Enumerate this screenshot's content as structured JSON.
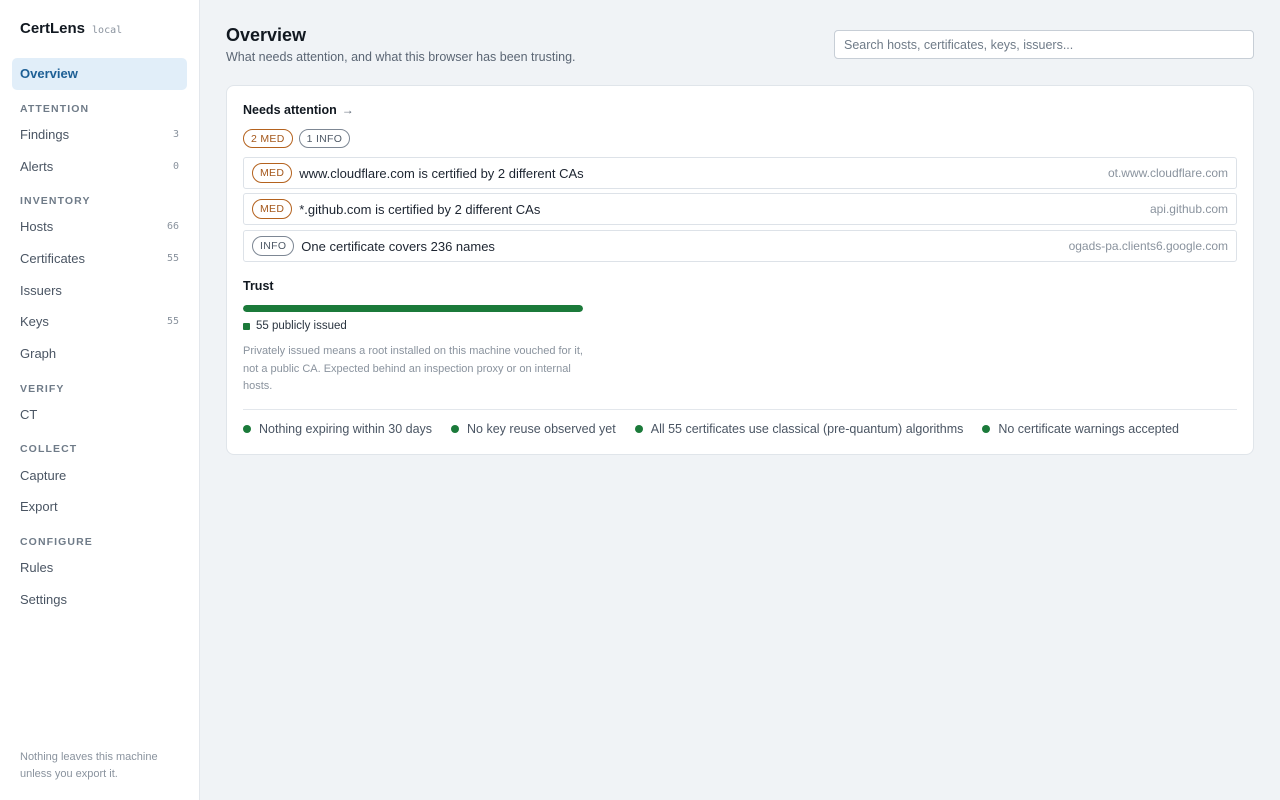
{
  "app": {
    "name": "CertLens",
    "tag": "local"
  },
  "sidebar": {
    "overview": "Overview",
    "sections": {
      "attention": "ATTENTION",
      "inventory": "INVENTORY",
      "verify": "VERIFY",
      "collect": "COLLECT",
      "configure": "CONFIGURE"
    },
    "items": {
      "findings": {
        "label": "Findings",
        "count": "3"
      },
      "alerts": {
        "label": "Alerts",
        "count": "0"
      },
      "hosts": {
        "label": "Hosts",
        "count": "66"
      },
      "certificates": {
        "label": "Certificates",
        "count": "55"
      },
      "issuers": {
        "label": "Issuers"
      },
      "keys": {
        "label": "Keys",
        "count": "55"
      },
      "graph": {
        "label": "Graph"
      },
      "ct": {
        "label": "CT"
      },
      "capture": {
        "label": "Capture"
      },
      "export": {
        "label": "Export"
      },
      "rules": {
        "label": "Rules"
      },
      "settings": {
        "label": "Settings"
      }
    },
    "footer": "Nothing leaves this machine unless you export it."
  },
  "header": {
    "title": "Overview",
    "subtitle": "What needs attention, and what this browser has been trusting.",
    "search_placeholder": "Search hosts, certificates, keys, issuers..."
  },
  "attention": {
    "heading": "Needs attention",
    "arrow": "→",
    "summary": {
      "med": "2 MED",
      "info": "1 INFO"
    },
    "findings": [
      {
        "severity": "MED",
        "title": "www.cloudflare.com is certified by 2 different CAs",
        "host": "ot.www.cloudflare.com"
      },
      {
        "severity": "MED",
        "title": "*.github.com is certified by 2 different CAs",
        "host": "api.github.com"
      },
      {
        "severity": "INFO",
        "title": "One certificate covers 236 names",
        "host": "ogads-pa.clients6.google.com"
      }
    ]
  },
  "trust": {
    "heading": "Trust",
    "public_fraction": 1.0,
    "legend": "55 publicly issued",
    "note": "Privately issued means a root installed on this machine vouched for it, not a public CA. Expected behind an inspection proxy or on internal hosts."
  },
  "checks": [
    "Nothing expiring within 30 days",
    "No key reuse observed yet",
    "All 55 certificates use classical (pre-quantum) algorithms",
    "No certificate warnings accepted"
  ],
  "colors": {
    "accent": "#1d5f95",
    "ok": "#1b7a3a",
    "med": "#b4621e",
    "info": "#7d8794"
  }
}
